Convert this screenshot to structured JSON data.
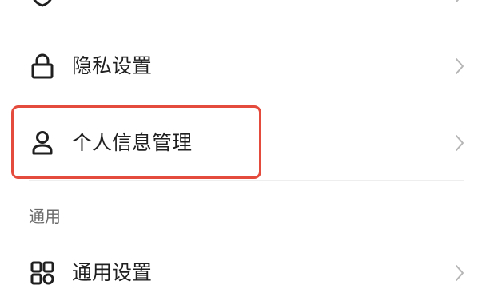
{
  "items": {
    "privacy": {
      "label": "隐私设置",
      "icon": "lock-icon"
    },
    "personal_info": {
      "label": "个人信息管理",
      "icon": "user-icon"
    },
    "general": {
      "label": "通用设置",
      "icon": "grid-icon"
    }
  },
  "top_partial_item": {
    "icon": "shield-icon"
  },
  "sections": {
    "general_header": "通用"
  },
  "colors": {
    "highlight": "#e54b3c",
    "text": "#1f1f1f",
    "section_text": "#6b6b6b",
    "chevron": "#b5b5b5",
    "divider": "#eeeeee"
  }
}
